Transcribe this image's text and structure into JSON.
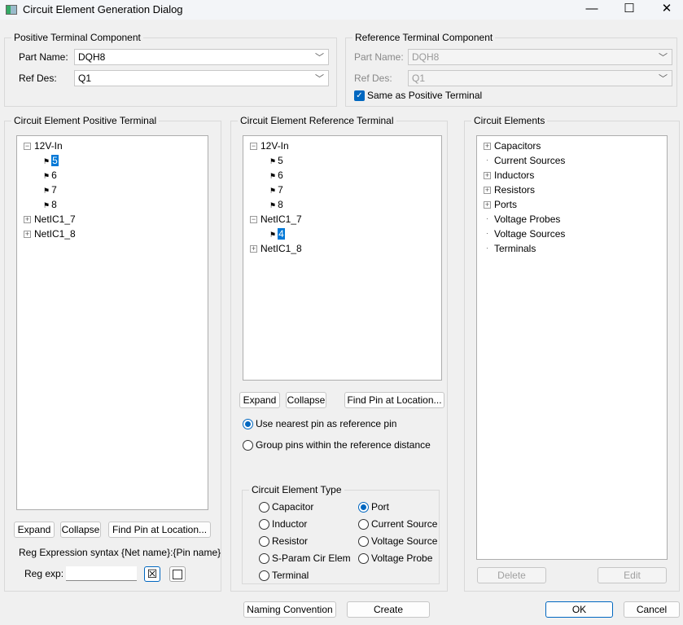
{
  "window": {
    "title": "Circuit Element Generation Dialog",
    "minimize": "—",
    "maximize": "☐",
    "close": "✕"
  },
  "positive_component": {
    "legend": "Positive Terminal Component",
    "part_label": "Part Name:",
    "part_value": "DQH8",
    "ref_label": "Ref Des:",
    "ref_value": "Q1"
  },
  "reference_component": {
    "legend": "Reference Terminal Component",
    "part_label": "Part Name:",
    "part_value": "DQH8",
    "ref_label": "Ref Des:",
    "ref_value": "Q1",
    "same_label": "Same as Positive Terminal",
    "same_checked": true
  },
  "positive_terminal": {
    "legend": "Circuit Element Positive Terminal",
    "tree": [
      {
        "label": "12V-In",
        "expanded": true,
        "children": [
          "5",
          "6",
          "7",
          "8"
        ],
        "selected": "5"
      },
      {
        "label": "NetIC1_7",
        "expanded": false
      },
      {
        "label": "NetIC1_8",
        "expanded": false
      }
    ],
    "expand": "Expand",
    "collapse": "Collapse",
    "find_pin": "Find Pin at Location...",
    "regex_syntax": "Reg Expression syntax {Net name}:{Pin name}",
    "regex_label": "Reg exp:",
    "regex_value": "",
    "regex_btn1": "☒",
    "regex_btn2": ""
  },
  "reference_terminal": {
    "legend": "Circuit Element Reference Terminal",
    "tree": [
      {
        "label": "12V-In",
        "expanded": true,
        "children": [
          "5",
          "6",
          "7",
          "8"
        ]
      },
      {
        "label": "NetIC1_7",
        "expanded": true,
        "children": [
          "4"
        ],
        "selected": "4"
      },
      {
        "label": "NetIC1_8",
        "expanded": false
      }
    ],
    "expand": "Expand",
    "collapse": "Collapse",
    "find_pin": "Find Pin at Location...",
    "options": [
      {
        "label": "Use nearest pin as reference pin",
        "checked": true
      },
      {
        "label": "Group pins within the reference distance",
        "checked": false
      }
    ]
  },
  "element_type": {
    "legend": "Circuit Element Type",
    "options": [
      {
        "label": "Capacitor",
        "checked": false
      },
      {
        "label": "Inductor",
        "checked": false
      },
      {
        "label": "Resistor",
        "checked": false
      },
      {
        "label": "S-Param Cir Elem",
        "checked": false
      },
      {
        "label": "Terminal",
        "checked": false
      },
      {
        "label": "Port",
        "checked": true
      },
      {
        "label": "Current Source",
        "checked": false
      },
      {
        "label": "Voltage Source",
        "checked": false
      },
      {
        "label": "Voltage Probe",
        "checked": false
      }
    ]
  },
  "circuit_elements": {
    "legend": "Circuit Elements",
    "items": [
      {
        "label": "Capacitors",
        "expandable": true
      },
      {
        "label": "Current Sources",
        "expandable": false
      },
      {
        "label": "Inductors",
        "expandable": true
      },
      {
        "label": "Resistors",
        "expandable": true
      },
      {
        "label": "Ports",
        "expandable": true
      },
      {
        "label": "Voltage Probes",
        "expandable": false
      },
      {
        "label": "Voltage Sources",
        "expandable": false
      },
      {
        "label": "Terminals",
        "expandable": false
      }
    ],
    "delete": "Delete",
    "edit": "Edit"
  },
  "footer": {
    "naming": "Naming Convention",
    "create": "Create",
    "ok": "OK",
    "cancel": "Cancel"
  }
}
